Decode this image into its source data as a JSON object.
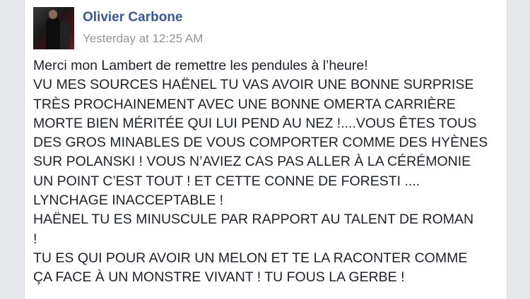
{
  "post": {
    "author": "Olivier Carbone",
    "timestamp": "Yesterday at 12:25 AM",
    "lines": [
      "Merci mon Lambert de remettre les pendules à l’heure!",
      "VU MES SOURCES HAËNEL TU VAS AVOIR UNE BONNE SURPRISE",
      "TRÈS PROCHAINEMENT AVEC UNE BONNE OMERTA CARRIÈRE",
      "MORTE BIEN MÉRITÉE QUI LUI PEND AU NEZ !....VOUS ÊTES TOUS",
      "DES GROS MINABLES DE VOUS COMPORTER COMME DES HYÈNES",
      "SUR POLANSKI ! VOUS N’AVIEZ CAS PAS ALLER À LA CÉRÉMONIE",
      "UN POINT C’EST TOUT ! ET CETTE CONNE DE FORESTI ....",
      "LYNCHAGE INACCEPTABLE !",
      "HAËNEL TU ES MINUSCULE PAR RAPPORT AU TALENT DE ROMAN",
      "!",
      "TU ES QUI POUR AVOIR UN MELON ET TE LA RACONTER COMME",
      "ÇA FACE À UN MONSTRE VIVANT ! TU FOUS LA GERBE !"
    ]
  }
}
